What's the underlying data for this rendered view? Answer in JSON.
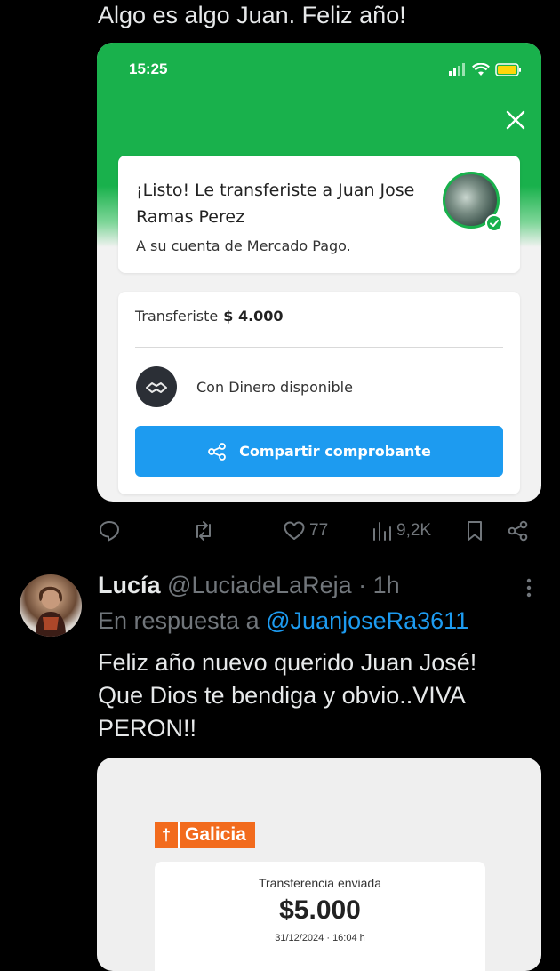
{
  "tweet1": {
    "text": "Algo es algo Juan. Feliz año!",
    "screenshot": {
      "status_time": "15:25",
      "success_title": "¡Listo! Le transferiste a Juan Jose Ramas Perez",
      "success_subtitle": "A su cuenta de Mercado Pago.",
      "amount_label": "Transferiste",
      "amount_value": "$ 4.000",
      "method_label": "Con Dinero disponible",
      "share_button": "Compartir comprobante",
      "brand_green": "#19b14c",
      "button_blue": "#1d9bf0"
    },
    "actions": {
      "likes": "77",
      "views": "9,2K"
    }
  },
  "tweet2": {
    "name": "Lucía",
    "handle": "@LuciadeLaReja",
    "dot": "·",
    "time": "1h",
    "reply_prefix": "En respuesta a",
    "reply_handle": "@JuanjoseRa3611",
    "text": "Feliz año nuevo querido Juan José! Que Dios te bendiga y obvio..VIVA PERON!!",
    "screenshot": {
      "bank_name": "Galicia",
      "bank_color": "#f26b1d",
      "label": "Transferencia enviada",
      "amount": "$5.000",
      "date": "31/12/2024 · 16:04 h"
    }
  }
}
